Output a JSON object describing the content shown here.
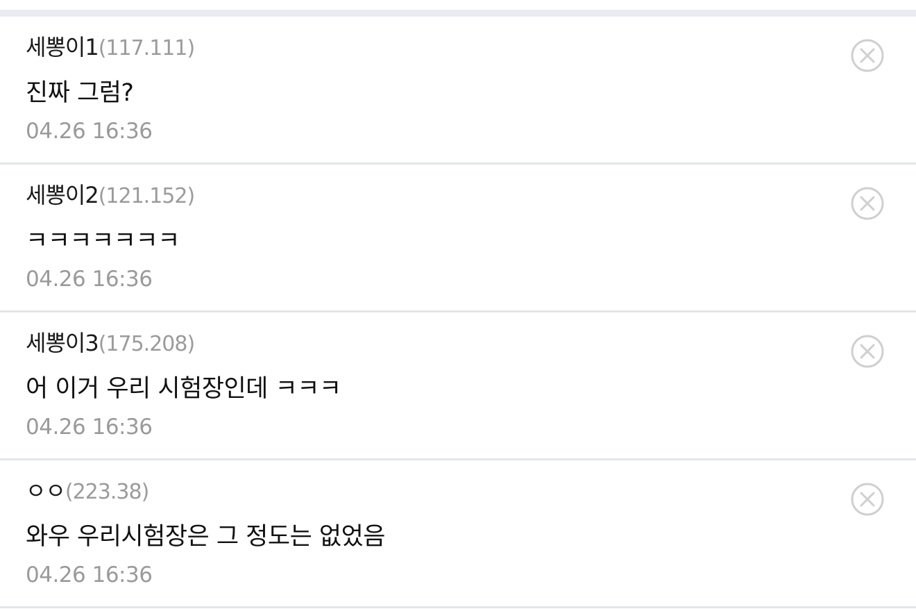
{
  "comments": [
    {
      "nick": "세뽕이1",
      "ip": "(117.111)",
      "text": "진짜 그럼?",
      "time": "04.26 16:36"
    },
    {
      "nick": "세뽕이2",
      "ip": "(121.152)",
      "text": "ㅋㅋㅋㅋㅋㅋㅋ",
      "time": "04.26 16:36"
    },
    {
      "nick": "세뽕이3",
      "ip": "(175.208)",
      "text": "어 이거 우리 시험장인데 ㅋㅋㅋ",
      "time": "04.26 16:36"
    },
    {
      "nick": "ㅇㅇ",
      "ip": "(223.38)",
      "text": "와우 우리시험장은 그 정도는 없었음",
      "time": "04.26 16:36"
    }
  ],
  "icons": {
    "delete": "close-circle-icon"
  },
  "colors": {
    "separator": "#e4e5ea",
    "top_stripe": "#eaebf0",
    "meta_text": "#9b9b9b",
    "icon": "#cfcfcf"
  }
}
